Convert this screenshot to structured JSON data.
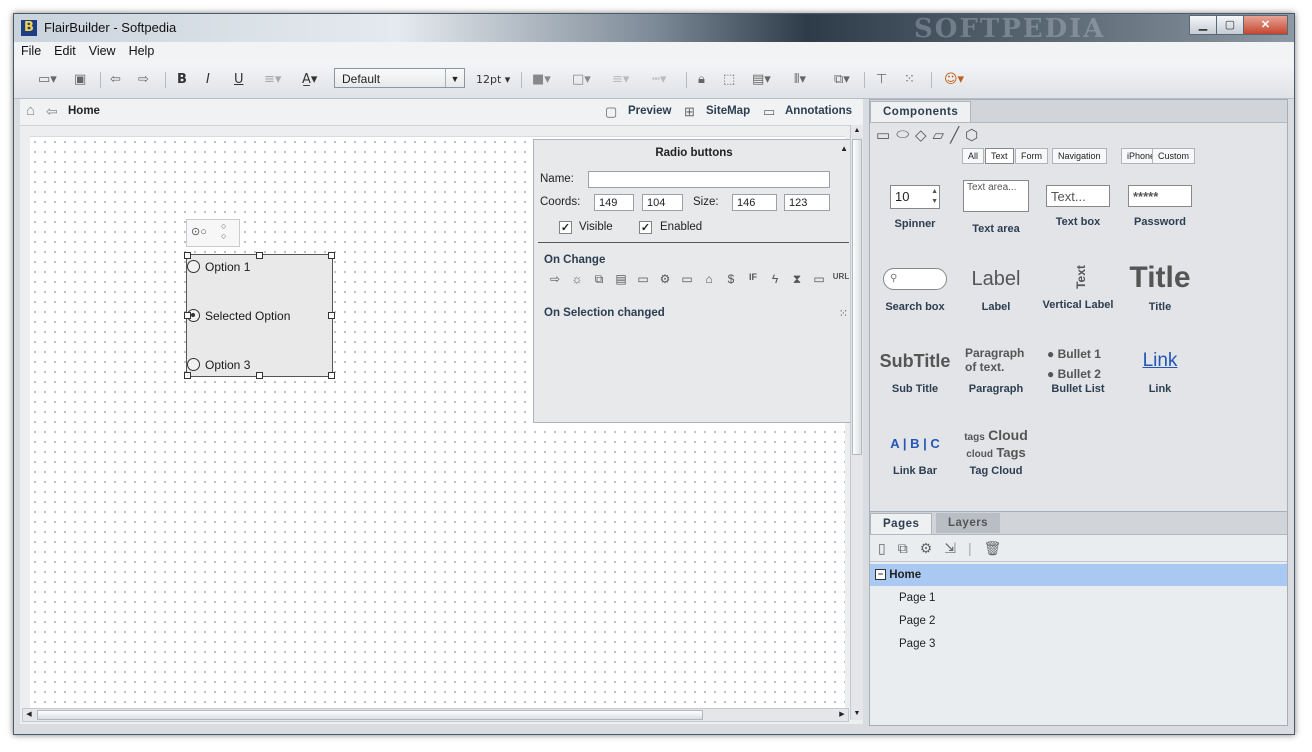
{
  "window": {
    "title": "FlairBuilder  - Softpedia",
    "app_icon": "B",
    "watermark": "SOFTPEDIA"
  },
  "menu": [
    "File",
    "Edit",
    "View",
    "Help"
  ],
  "toolbar": {
    "font_name": "Default",
    "font_size": "12pt"
  },
  "breadcrumb": {
    "current": "Home",
    "preview": "Preview",
    "sitemap": "SiteMap",
    "annotations": "Annotations"
  },
  "canvas": {
    "radio_options": [
      "Option 1",
      "Selected Option",
      "Option 3"
    ]
  },
  "properties": {
    "title": "Radio buttons",
    "name_label": "Name:",
    "name_value": "",
    "coords_label": "Coords:",
    "coord_x": "149",
    "coord_y": "104",
    "size_label": "Size:",
    "size_w": "146",
    "size_h": "123",
    "visible_label": "Visible",
    "enabled_label": "Enabled",
    "on_change": "On Change",
    "on_selection_changed": "On Selection changed"
  },
  "components": {
    "tabs": [
      "Components"
    ],
    "filters": [
      "All",
      "Text",
      "Form",
      "Navigation",
      "iPhone",
      "Custom"
    ],
    "items": [
      {
        "label": "Spinner",
        "preview": "10"
      },
      {
        "label": "Text area",
        "preview": "Text area..."
      },
      {
        "label": "Text box",
        "preview": "Text..."
      },
      {
        "label": "Password",
        "preview": "*****"
      },
      {
        "label": "Search box",
        "preview": ""
      },
      {
        "label": "Label",
        "preview": "Label"
      },
      {
        "label": "Vertical Label",
        "preview": "Text"
      },
      {
        "label": "Title",
        "preview": "Title"
      },
      {
        "label": "Sub Title",
        "preview": "SubTitle"
      },
      {
        "label": "Paragraph",
        "preview": "Paragraph of text."
      },
      {
        "label": "Bullet List",
        "preview_1": "Bullet 1",
        "preview_2": "Bullet 2"
      },
      {
        "label": "Link",
        "preview": "Link"
      },
      {
        "label": "Link Bar",
        "preview": "A | B | C"
      },
      {
        "label": "Tag Cloud",
        "preview_a": "tags",
        "preview_b": "Cloud",
        "preview_c": "cloud",
        "preview_d": "Tags"
      }
    ]
  },
  "pages": {
    "tabs": [
      "Pages",
      "Layers"
    ],
    "tree": [
      "Home",
      "Page 1",
      "Page 2",
      "Page 3"
    ],
    "tree_toggle": "−"
  },
  "colors": {
    "selection": "#a9c9f2",
    "link": "#2456b8",
    "titlebar_dark": "#2e3b48"
  }
}
